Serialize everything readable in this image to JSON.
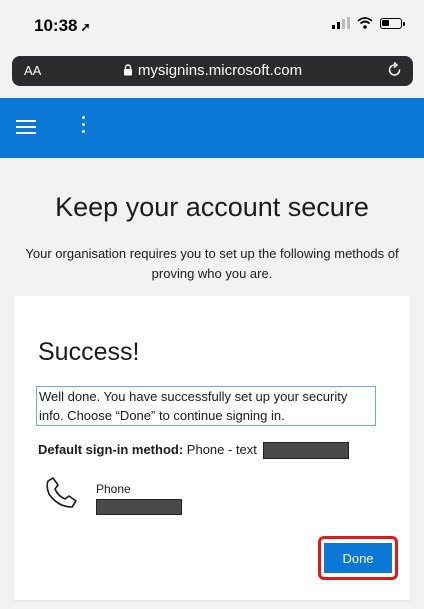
{
  "status_bar": {
    "time": "10:38",
    "location_icon": "location-arrow-icon"
  },
  "browser": {
    "text_size_label": "AA",
    "url": "mysignins.microsoft.com"
  },
  "header": {
    "menu_icon": "hamburger-icon",
    "more_icon": "kebab-icon",
    "color": "#0a78d4"
  },
  "page": {
    "title": "Keep your account secure",
    "description": "Your organisation requires you to set up the following methods of proving who you are."
  },
  "card": {
    "title": "Success!",
    "message": "Well done. You have successfully set up your security info. Choose “Done” to continue signing in.",
    "default_method_label": "Default sign-in method:",
    "default_method_value": "Phone - text",
    "method_name": "Phone",
    "done_label": "Done"
  },
  "colors": {
    "accent": "#0a78d4",
    "highlight": "#e01919"
  }
}
